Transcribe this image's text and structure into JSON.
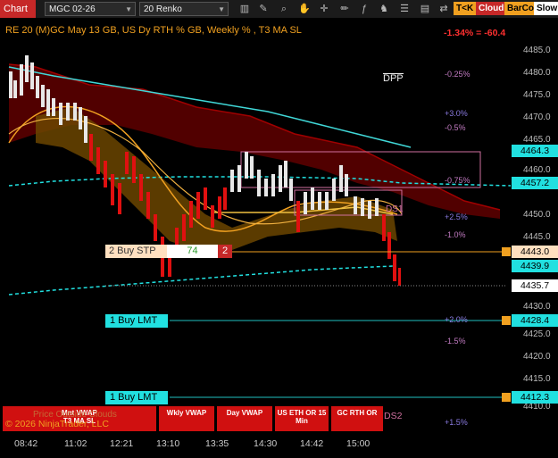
{
  "toolbar": {
    "tab_label": "Chart",
    "instrument": "MGC 02-26",
    "period": "20 Renko",
    "buttons": [
      "T<K",
      "Cloud",
      "BarCol",
      "SlowM"
    ]
  },
  "chart": {
    "header": "RE 20  (M)GC May 13 GB, US Dy RTH % GB, Weekly % , T3 MA SL",
    "top_pct": "-1.34% = -60.4",
    "dpp_label": "DPP",
    "ds1_label": "DS1",
    "ds2_label": "DS2",
    "pct_labels": [
      {
        "text": "-0.25%",
        "color": "#c07ac0"
      },
      {
        "text": "+3.0%",
        "color": "#8a7ae0"
      },
      {
        "text": "-0.5%",
        "color": "#c07ac0"
      },
      {
        "text": "-0.75%",
        "color": "#c07ac0"
      },
      {
        "text": "+2.5%",
        "color": "#8a7ae0"
      },
      {
        "text": "-1.0%",
        "color": "#c07ac0"
      },
      {
        "text": "+2.0%",
        "color": "#8a7ae0"
      },
      {
        "text": "-1.5%",
        "color": "#c07ac0"
      },
      {
        "text": "+1.5%",
        "color": "#8a7ae0"
      }
    ],
    "copyright": "© 2026 NinjaTrader, LLC",
    "watermark": "Price Outside Clouds",
    "order_stp": {
      "label": "2 Buy STP",
      "qty": "74",
      "count": "2"
    },
    "order_lmt1": {
      "label": "1 Buy LMT"
    },
    "order_lmt2": {
      "label": "1 Buy LMT"
    }
  },
  "price_axis": {
    "labels": [
      "4485.0",
      "4480.0",
      "4475.0",
      "4470.0",
      "4465.0",
      "4460.0",
      "4455.0",
      "4450.0",
      "4445.0",
      "4440.0",
      "4435.0",
      "4430.0",
      "4425.0",
      "4420.0",
      "4415.0",
      "4410.0"
    ],
    "tags": [
      {
        "text": "4464.3",
        "bg": "#21e0e0"
      },
      {
        "text": "4457.2",
        "bg": "#21e0e0"
      },
      {
        "text": "4443.0",
        "bg": "#ffe0c0"
      },
      {
        "text": "4439.9",
        "bg": "#21e0e0"
      },
      {
        "text": "4435.7",
        "bg": "#ffffff"
      },
      {
        "text": "4428.4",
        "bg": "#21e0e0"
      },
      {
        "text": "4412.3",
        "bg": "#21e0e0"
      }
    ]
  },
  "time_axis": [
    "08:42",
    "11:02",
    "12:21",
    "13:10",
    "13:35",
    "14:30",
    "14:42",
    "15:00"
  ],
  "bottom_buttons": [
    {
      "text": "Mnt VWAP\nT3 MA SL"
    },
    {
      "text": "Wkly VWAP"
    },
    {
      "text": "Day VWAP"
    },
    {
      "text": "US ETH OR 15 Min"
    },
    {
      "text": "GC RTH OR"
    }
  ]
}
